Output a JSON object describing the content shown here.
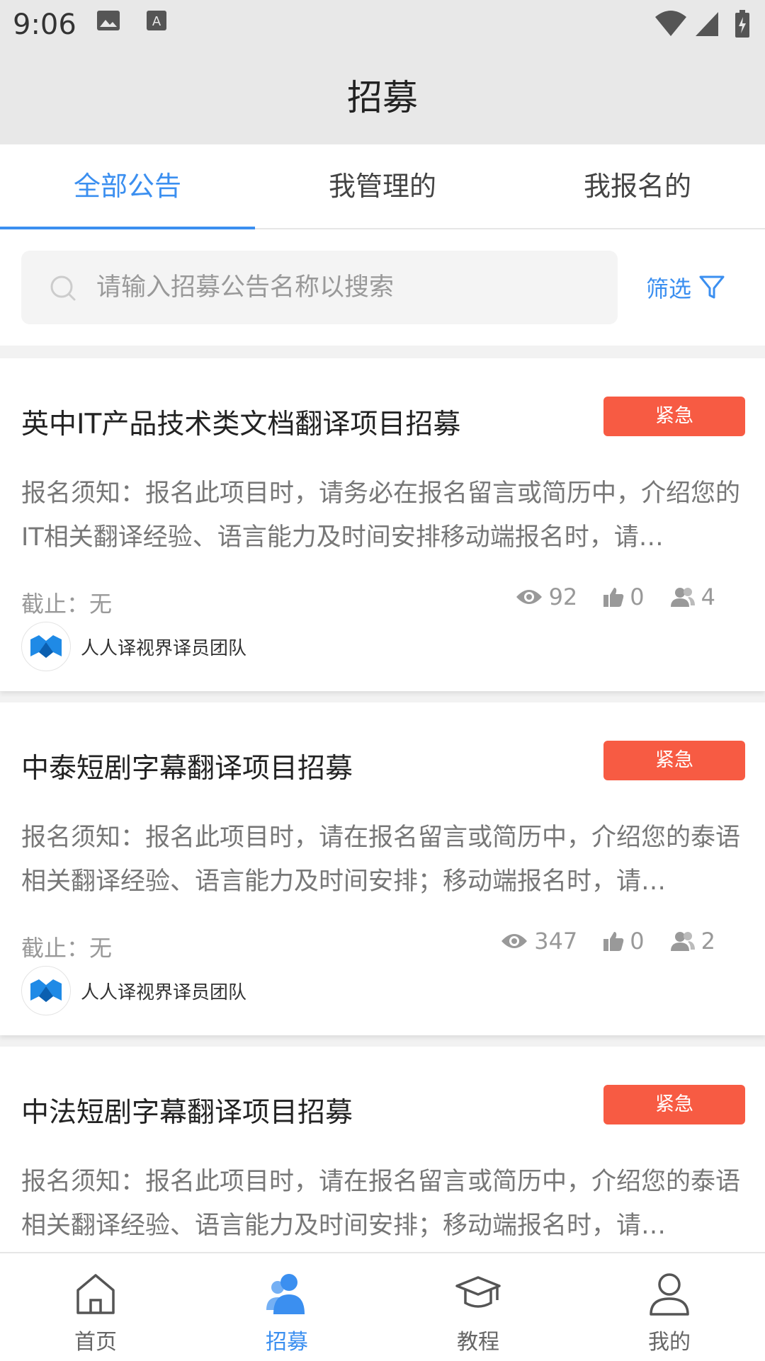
{
  "status_bar": {
    "time": "9:06"
  },
  "header": {
    "title": "招募"
  },
  "tabs": [
    {
      "label": "全部公告",
      "active": true
    },
    {
      "label": "我管理的",
      "active": false
    },
    {
      "label": "我报名的",
      "active": false
    }
  ],
  "search": {
    "placeholder": "请输入招募公告名称以搜索",
    "filter_label": "筛选"
  },
  "colors": {
    "accent": "#3b8ff0",
    "urgent": "#f75b43"
  },
  "cards": [
    {
      "title": "英中IT产品技术类文档翻译项目招募",
      "badge": "紧急",
      "desc": "报名须知：报名此项目时，请务必在报名留言或简历中，介绍您的IT相关翻译经验、语言能力及时间安排移动端报名时，请…",
      "deadline": "截止：无",
      "views": "92",
      "likes": "0",
      "applicants": "4",
      "org": "人人译视界译员团队"
    },
    {
      "title": "中泰短剧字幕翻译项目招募",
      "badge": "紧急",
      "desc": "报名须知：报名此项目时，请在报名留言或简历中，介绍您的泰语相关翻译经验、语言能力及时间安排；移动端报名时，请…",
      "deadline": "截止：无",
      "views": "347",
      "likes": "0",
      "applicants": "2",
      "org": "人人译视界译员团队"
    },
    {
      "title": "中法短剧字幕翻译项目招募",
      "badge": "紧急",
      "desc": "报名须知：报名此项目时，请在报名留言或简历中，介绍您的泰语相关翻译经验、语言能力及时间安排；移动端报名时，请…"
    }
  ],
  "bottom_nav": [
    {
      "label": "首页",
      "icon": "home-icon",
      "active": false
    },
    {
      "label": "招募",
      "icon": "people-icon",
      "active": true
    },
    {
      "label": "教程",
      "icon": "graduation-cap-icon",
      "active": false
    },
    {
      "label": "我的",
      "icon": "user-icon",
      "active": false
    }
  ]
}
